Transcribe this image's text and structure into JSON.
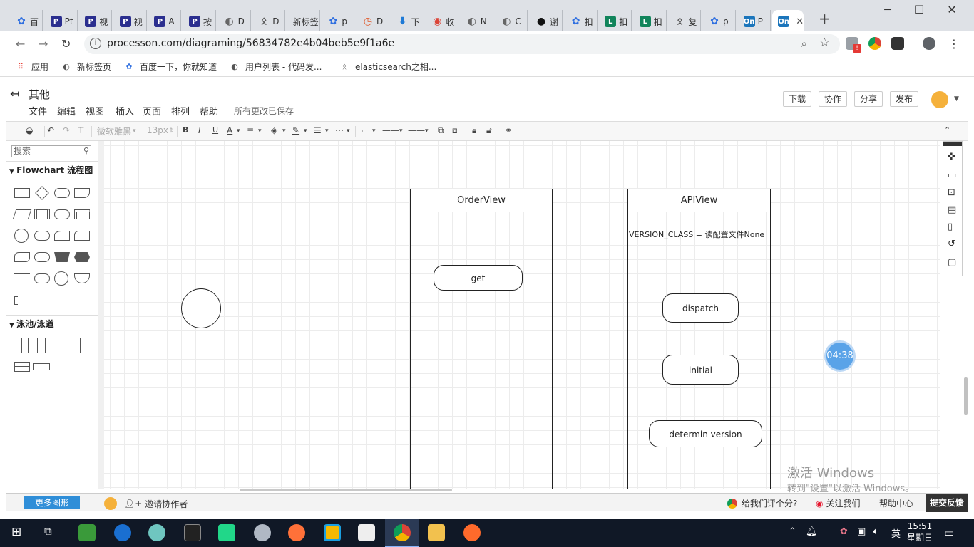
{
  "browser": {
    "tabs": [
      {
        "icon": "paw-icon",
        "color": "#2f6fe0",
        "label": "百"
      },
      {
        "icon": "p-logo-icon",
        "color": "#2b2f8f",
        "label": "Pt"
      },
      {
        "icon": "p-logo-icon",
        "color": "#2b2f8f",
        "label": "视"
      },
      {
        "icon": "p-logo-icon",
        "color": "#2b2f8f",
        "label": "视"
      },
      {
        "icon": "p-logo-icon",
        "color": "#2b2f8f",
        "label": "A"
      },
      {
        "icon": "p-logo-icon",
        "color": "#2b2f8f",
        "label": "按"
      },
      {
        "icon": "globe-icon",
        "color": "#666666",
        "label": "D"
      },
      {
        "icon": "feather-icon",
        "color": "#555555",
        "label": "D"
      },
      {
        "icon": "none",
        "color": "#ffffff",
        "label": "新标签"
      },
      {
        "icon": "paw-icon",
        "color": "#2f6fe0",
        "label": "p"
      },
      {
        "icon": "compass-icon",
        "color": "#e05a2b",
        "label": "D"
      },
      {
        "icon": "download-icon",
        "color": "#1e7ad6",
        "label": "下"
      },
      {
        "icon": "chrome-icon",
        "color": "#db4437",
        "label": "收"
      },
      {
        "icon": "globe-icon",
        "color": "#666666",
        "label": "N"
      },
      {
        "icon": "globe-icon",
        "color": "#666666",
        "label": "C"
      },
      {
        "icon": "github-icon",
        "color": "#111111",
        "label": "谢"
      },
      {
        "icon": "paw-icon",
        "color": "#2f6fe0",
        "label": "扣"
      },
      {
        "icon": "l-logo-icon",
        "color": "#11845b",
        "label": "扣"
      },
      {
        "icon": "l-logo-icon",
        "color": "#11845b",
        "label": "扣"
      },
      {
        "icon": "feather-icon",
        "color": "#555555",
        "label": "复"
      },
      {
        "icon": "paw-icon",
        "color": "#2f6fe0",
        "label": "p"
      },
      {
        "icon": "on-logo-icon",
        "color": "#1b75bb",
        "label": "P"
      },
      {
        "icon": "on-logo-icon",
        "color": "#1b75bb",
        "label": "",
        "active": true
      }
    ],
    "url": "processon.com/diagraming/56834782e4b04beb5e9f1a6e",
    "bookmarks": [
      {
        "icon": "apps-icon",
        "label": "应用"
      },
      {
        "icon": "globe-icon",
        "label": "新标签页"
      },
      {
        "icon": "paw-icon",
        "label": "百度一下，你就知道"
      },
      {
        "icon": "globe-icon",
        "label": "用户列表 - 代码发..."
      },
      {
        "icon": "feather-icon",
        "label": "elasticsearch之相..."
      }
    ]
  },
  "app": {
    "title": "其他",
    "menu": [
      "文件",
      "编辑",
      "视图",
      "插入",
      "页面",
      "排列",
      "帮助"
    ],
    "saved_status": "所有更改已保存",
    "header_buttons": [
      "下载",
      "协作",
      "分享",
      "发布"
    ],
    "toolbar": {
      "font_family": "微软雅黑",
      "font_size": "13px"
    }
  },
  "sidebar": {
    "search_placeholder": "搜索",
    "section_flowchart": "Flowchart 流程图",
    "section_swimlane": "泳池/泳道"
  },
  "canvas": {
    "lanes": [
      {
        "title": "OrderView"
      },
      {
        "title": "APIView"
      }
    ],
    "nodes": {
      "get": "get",
      "dispatch": "dispatch",
      "initial": "initial",
      "determin": "determin  version"
    },
    "version_text": "VERSION_CLASS = 读配置文件None",
    "timer": "04:38"
  },
  "watermark": {
    "line1": "激活 Windows",
    "line2": "转到\"设置\"以激活 Windows。"
  },
  "footer": {
    "more_shapes": "更多图形",
    "invite": "邀请协作者",
    "rate": "给我们评个分?",
    "follow": "关注我们",
    "help": "帮助中心",
    "feedback": "提交反馈"
  },
  "taskbar": {
    "time": "15:51",
    "day": "星期日",
    "ime": "英"
  }
}
